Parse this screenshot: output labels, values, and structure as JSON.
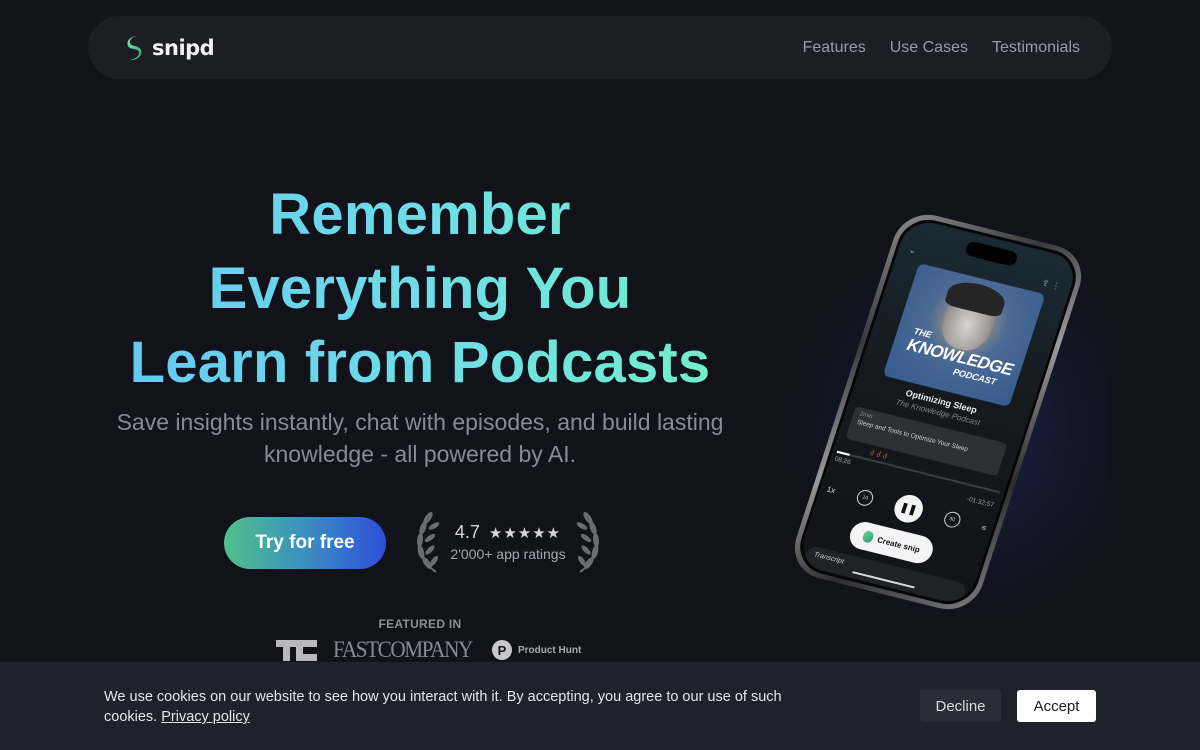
{
  "nav": {
    "brand": "snipd",
    "links": [
      "Features",
      "Use Cases",
      "Testimonials"
    ]
  },
  "hero": {
    "headline_lines": [
      "Remember",
      "Everything You",
      "Learn from Podcasts"
    ],
    "subheadline": "Save insights instantly, chat with episodes, and build lasting knowledge - all powered by AI.",
    "cta_label": "Try for free",
    "rating": {
      "score": "4.7",
      "stars": "★★★★★",
      "star_count": 5,
      "caption": "2'000+ app ratings"
    },
    "featured_label": "FEATURED IN",
    "press": [
      "TechCrunch",
      "FAST COMPANY",
      "Product Hunt"
    ],
    "press_fc_text": "FASTCOMPANY",
    "press_ph_letter": "P",
    "press_ph_text": "Product Hunt"
  },
  "phone": {
    "art_line1": "THE",
    "art_line2": "KNOWLEDGE",
    "art_line3": "PODCAST",
    "episode_title": "Optimizing Sleep",
    "podcast_name": "The Knowledge Podcast",
    "chapter_duration": "2min",
    "chapter_title": "Sleep and Tools to Optimize Your Sleep",
    "snip_markers": "ძძძ",
    "progress_fraction": 0.08,
    "elapsed": "08:26",
    "remaining": "-01:32:57",
    "speed": "1x",
    "skip_back": "10",
    "skip_forward": "30",
    "play_state_icon": "❚❚",
    "create_snip_label": "Create snip",
    "transcript_label": "Transcript"
  },
  "cookie_banner": {
    "text": "We use cookies on our website to see how you interact with it. By accepting, you agree to our use of such cookies.",
    "privacy_link": "Privacy policy",
    "decline_label": "Decline",
    "accept_label": "Accept"
  },
  "colors": {
    "background": "#12121b",
    "nav_bg": "#1d1d26",
    "headline_gradient": [
      "#62c8f2",
      "#72f2c6"
    ],
    "cta_gradient": [
      "#4fc28b",
      "#2d4fd9"
    ],
    "cookie_bg": "#1f222c",
    "brand_green": "#4fd08f"
  }
}
